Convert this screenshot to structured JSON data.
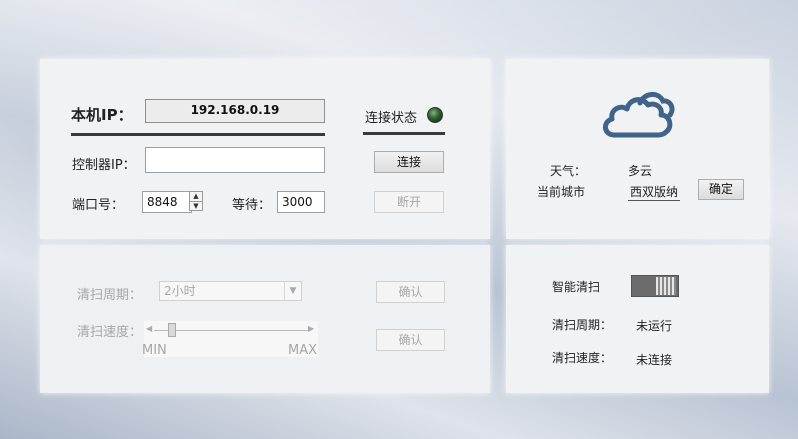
{
  "network": {
    "local_ip_label": "本机IP：",
    "local_ip_value": "192.168.0.19",
    "conn_status_label": "连接状态",
    "controller_ip_label": "控制器IP：",
    "controller_ip_value": "",
    "connect_button": "连接",
    "port_label": "端口号：",
    "port_value": "8848",
    "wait_label": "等待：",
    "wait_value": "3000",
    "disconnect_button": "断开"
  },
  "weather": {
    "icon": "cloud-icon",
    "weather_label": "天气：",
    "weather_value": "多云",
    "city_label": "当前城市",
    "city_value": "西双版纳",
    "confirm_button": "确定"
  },
  "cleaning_controls": {
    "period_label": "清扫周期：",
    "period_selected": "2小时",
    "period_confirm": "确认",
    "speed_label": "清扫速度：",
    "speed_min": "MIN",
    "speed_max": "MAX",
    "speed_confirm": "确认"
  },
  "status": {
    "smart_clean_label": "智能清扫",
    "period_label": "清扫周期：",
    "period_value": "未运行",
    "speed_label": "清扫速度：",
    "speed_value": "未连接"
  },
  "colors": {
    "led": "#2f5f2f",
    "cloud_stroke": "#3f6389"
  }
}
